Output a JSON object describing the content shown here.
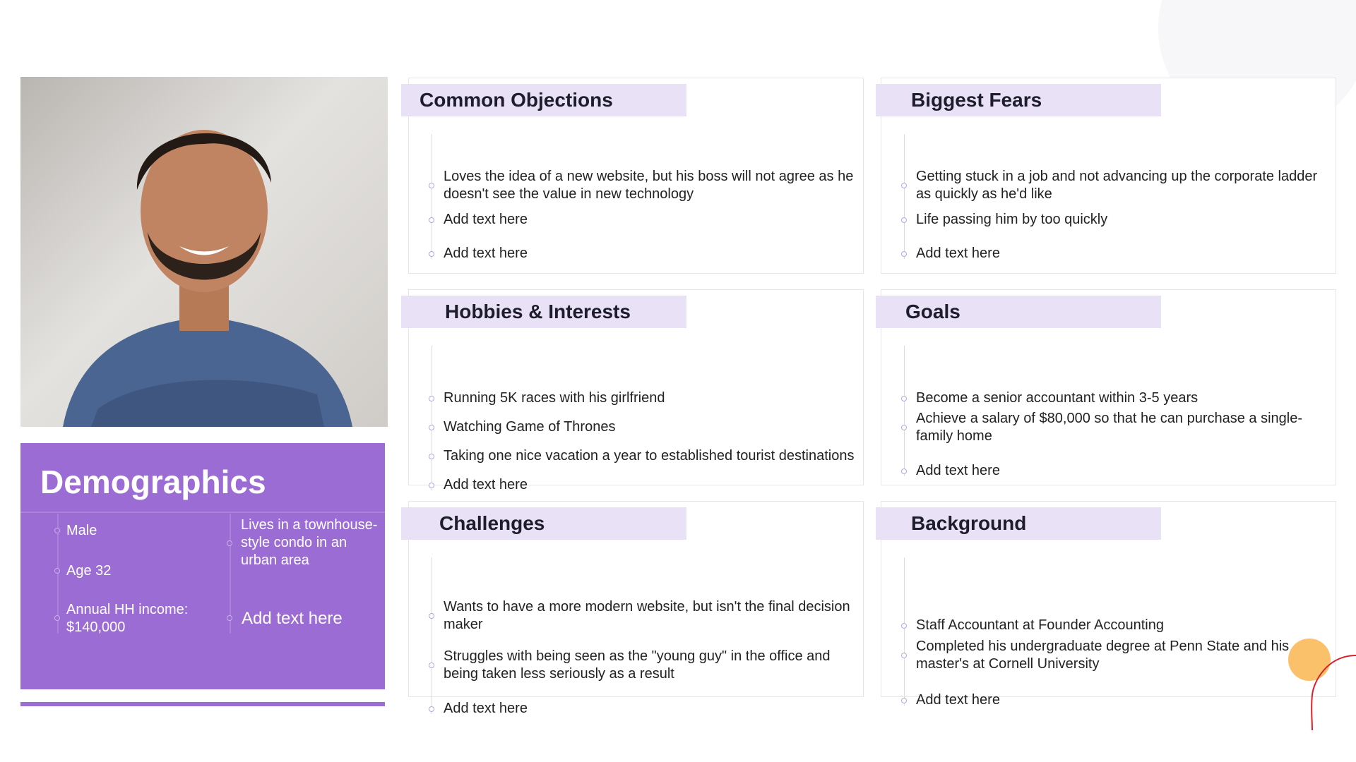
{
  "demographics": {
    "title": "Demographics",
    "left": [
      "Male",
      "Age 32",
      "Annual HH income: $140,000"
    ],
    "right": [
      "Lives in a townhouse-style condo in an urban area",
      "Add text here"
    ]
  },
  "cards": {
    "objections": {
      "title": "Common Objections",
      "items": [
        "Loves the idea of a new website, but his boss will not agree as he doesn't see the value in new technology",
        "Add text here",
        "Add text here"
      ]
    },
    "fears": {
      "title": "Biggest Fears",
      "items": [
        "Getting stuck in a job and not advancing up the corporate ladder as quickly as he'd like",
        "Life passing him by too quickly",
        "Add text here"
      ]
    },
    "hobbies": {
      "title": "Hobbies & Interests",
      "items": [
        "Running 5K races with his girlfriend",
        "Watching Game of Thrones",
        "Taking one nice vacation a year to established tourist destinations",
        "Add text here"
      ]
    },
    "goals": {
      "title": "Goals",
      "items": [
        "Become a senior accountant within 3-5 years",
        "Achieve a salary of $80,000 so that he can purchase a single-family home",
        "Add text here"
      ]
    },
    "challenges": {
      "title": "Challenges",
      "items": [
        "Wants to have a more modern website, but isn't the final decision maker",
        "Struggles with being seen as the \"young guy\" in the office and being taken less seriously as a result",
        "Add text here"
      ]
    },
    "background": {
      "title": "Background",
      "items": [
        "Staff Accountant at Founder Accounting",
        "Completed his undergraduate degree at Penn State and his master's at Cornell University",
        "Add text here"
      ]
    }
  },
  "colors": {
    "accent": "#9b6cd4",
    "band": "#e9e2f6",
    "orange": "#fbc06a"
  }
}
